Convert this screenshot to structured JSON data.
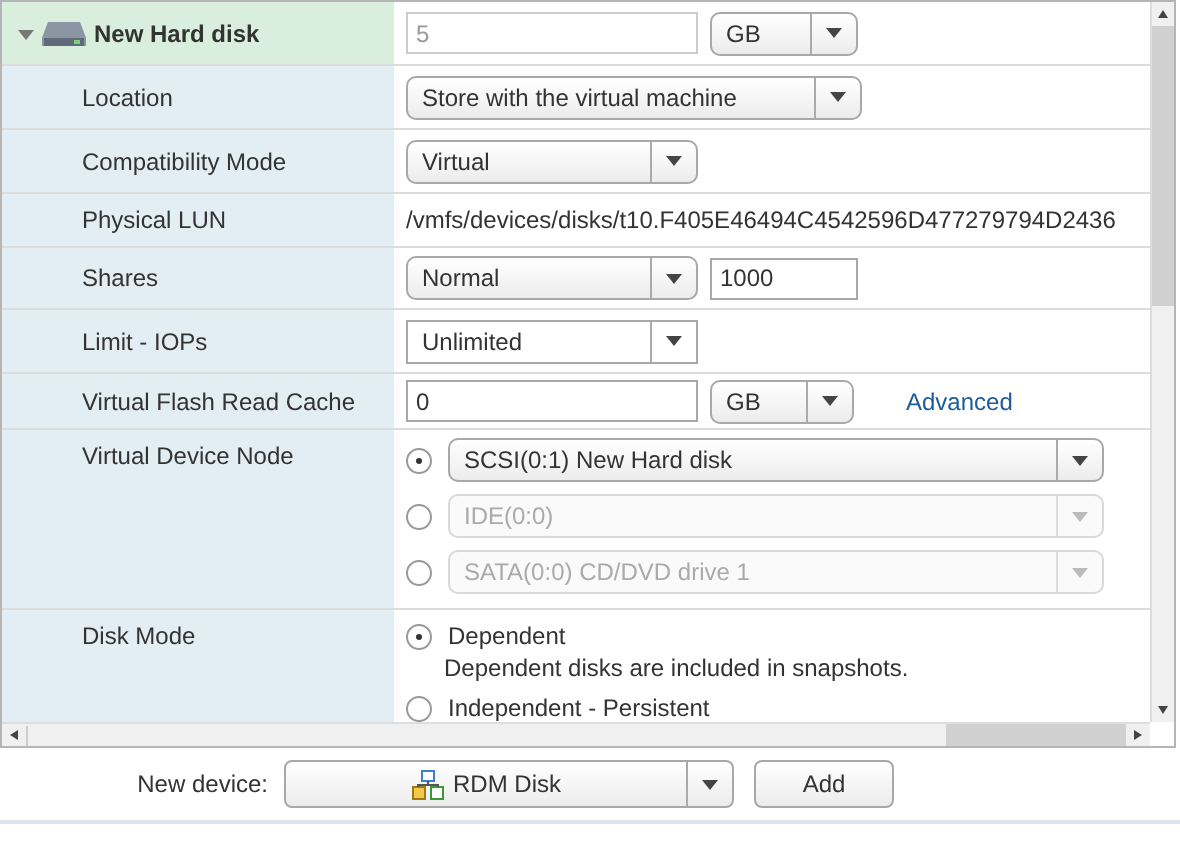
{
  "device": {
    "title": "New Hard disk",
    "expanded": true,
    "size": {
      "value": "5",
      "disabled": true
    },
    "unit": "GB"
  },
  "rows": [
    {
      "kind": "wide_select",
      "label": "Location",
      "value": "Store with the virtual machine"
    },
    {
      "kind": "select",
      "label": "Compatibility Mode",
      "value": "Virtual"
    },
    {
      "kind": "text",
      "label": "Physical LUN",
      "value": "/vmfs/devices/disks/t10.F405E46494C4542596D477279794D2436"
    },
    {
      "kind": "select_input",
      "label": "Shares",
      "value": "Normal",
      "input": "1000"
    },
    {
      "kind": "combo",
      "label": "Limit - IOPs",
      "value": "Unlimited"
    },
    {
      "kind": "input_unit",
      "label": "Virtual Flash Read Cache",
      "value": "0",
      "unit": "GB",
      "link": "Advanced"
    },
    {
      "kind": "radio_selects",
      "label": "Virtual Device Node",
      "options": [
        {
          "value": "SCSI(0:1) New Hard disk",
          "selected": true,
          "disabled": false
        },
        {
          "value": "IDE(0:0)",
          "selected": false,
          "disabled": true
        },
        {
          "value": "SATA(0:0) CD/DVD drive 1",
          "selected": false,
          "disabled": true
        }
      ]
    },
    {
      "kind": "radio_options",
      "label": "Disk Mode",
      "options": [
        {
          "value": "Dependent",
          "description": "Dependent disks are included in snapshots.",
          "selected": true
        },
        {
          "value": "Independent - Persistent",
          "selected": false
        }
      ]
    }
  ],
  "footer": {
    "label": "New device:",
    "device": "RDM Disk",
    "button": "Add"
  }
}
